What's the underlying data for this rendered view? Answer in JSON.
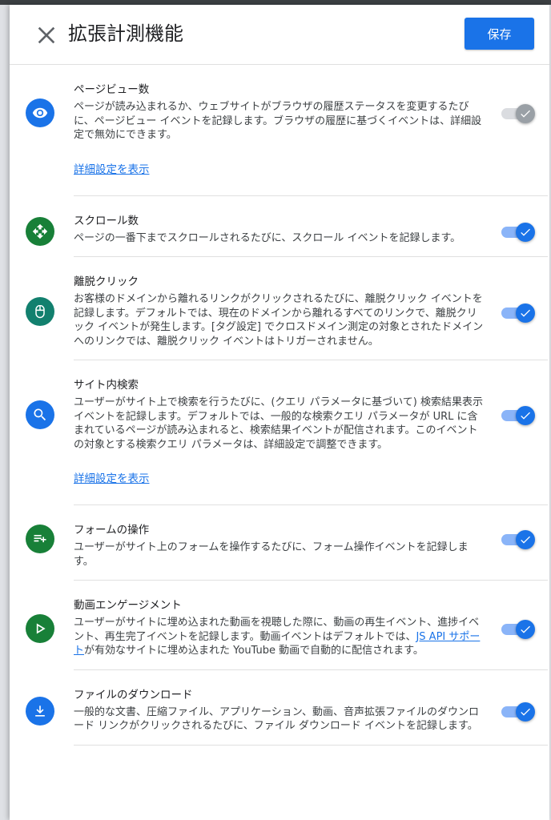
{
  "header": {
    "title": "拡張計測機能",
    "save_label": "保存"
  },
  "colors": {
    "accent": "#1a73e8",
    "green": "#188038",
    "teal": "#12806e"
  },
  "items": [
    {
      "title": "ページビュー数",
      "desc": "ページが読み込まれるか、ウェブサイトがブラウザの履歴ステータスを変更するたびに、ページビュー イベントを記録します。ブラウザの履歴に基づくイベントは、詳細設定で無効にできます。",
      "link": "詳細設定を表示",
      "enabled": true,
      "toggle_disabled": true,
      "icon": "eye-icon"
    },
    {
      "title": "スクロール数",
      "desc": "ページの一番下までスクロールされるたびに、スクロール イベントを記録します。",
      "enabled": true,
      "icon": "scroll-arrows-icon"
    },
    {
      "title": "離脱クリック",
      "desc": "お客様のドメインから離れるリンクがクリックされるたびに、離脱クリック イベントを記録します。デフォルトでは、現在のドメインから離れるすべてのリンクで、離脱クリック イベントが発生します。[タグ設定] でクロスドメイン測定の対象とされたドメインへのリンクでは、離脱クリック イベントはトリガーされません。",
      "enabled": true,
      "icon": "mouse-icon"
    },
    {
      "title": "サイト内検索",
      "desc": "ユーザーがサイト上で検索を行うたびに、(クエリ パラメータに基づいて) 検索結果表示イベントを記録します。デフォルトでは、一般的な検索クエリ パラメータが URL に含まれているページが読み込まれると、検索結果イベントが配信されます。このイベントの対象とする検索クエリ パラメータは、詳細設定で調整できます。",
      "link": "詳細設定を表示",
      "enabled": true,
      "icon": "search-icon"
    },
    {
      "title": "フォームの操作",
      "desc": "ユーザーがサイト上のフォームを操作するたびに、フォーム操作イベントを記録します。",
      "enabled": true,
      "icon": "playlist-add-icon"
    },
    {
      "title": "動画エンゲージメント",
      "desc_before": "ユーザーがサイトに埋め込まれた動画を視聴した際に、動画の再生イベント、進捗イベント、再生完了イベントを記録します。動画イベントはデフォルトでは、",
      "desc_link": "JS API サポート",
      "desc_after": "が有効なサイトに埋め込まれた YouTube 動画で自動的に配信されます。",
      "enabled": true,
      "icon": "play-icon"
    },
    {
      "title": "ファイルのダウンロード",
      "desc": "一般的な文書、圧縮ファイル、アプリケーション、動画、音声拡張ファイルのダウンロード リンクがクリックされるたびに、ファイル ダウンロード イベントを記録します。",
      "enabled": true,
      "icon": "download-icon"
    }
  ]
}
